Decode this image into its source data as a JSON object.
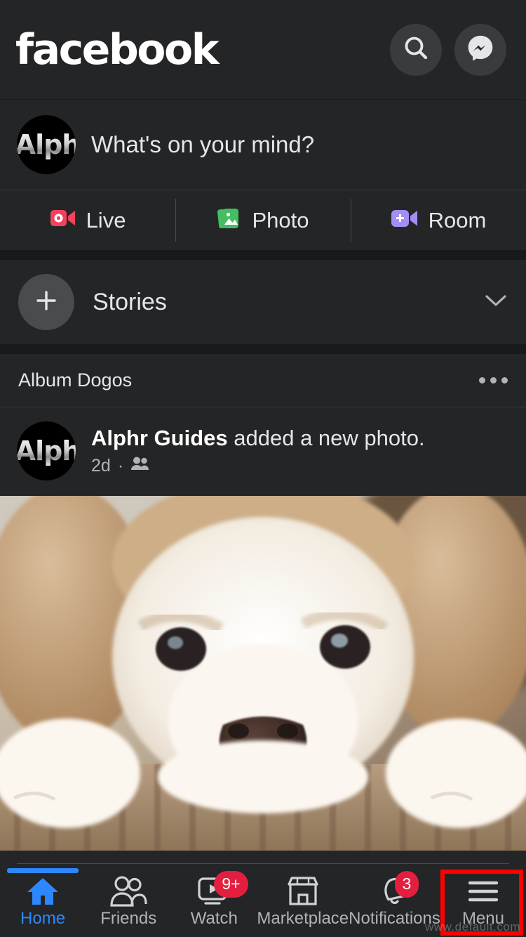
{
  "app": {
    "brand": "facebook",
    "theme_bg": "#242526",
    "page_bg": "#18191a",
    "accent": "#2d88ff",
    "badge_color": "#e41e3f",
    "highlight_color": "#ff0000"
  },
  "header": {
    "wordmark": "facebook",
    "search_icon": "search-icon",
    "messenger_icon": "messenger-icon"
  },
  "composer": {
    "avatar_text": "Alph",
    "placeholder": "What's on your mind?",
    "actions": [
      {
        "label": "Live",
        "icon": "live-video-icon",
        "color": "#f3425f"
      },
      {
        "label": "Photo",
        "icon": "photo-icon",
        "color": "#45bd62"
      },
      {
        "label": "Room",
        "icon": "video-room-icon",
        "color": "#a48df5"
      }
    ]
  },
  "stories": {
    "add_icon": "plus-icon",
    "title": "Stories",
    "collapse_icon": "chevron-down-icon"
  },
  "album": {
    "label": "Album Dogos",
    "menu_icon": "more-options-icon"
  },
  "post": {
    "avatar_text": "Alph",
    "author": "Alphr Guides",
    "action_text": " added a new photo.",
    "time": "2d",
    "separator": "·",
    "audience_icon": "friends-audience-icon",
    "photo_alt": "puppy-photo"
  },
  "bottom_nav": {
    "items": [
      {
        "label": "Home",
        "icon": "home-icon",
        "active": true,
        "badge": ""
      },
      {
        "label": "Friends",
        "icon": "friends-icon",
        "active": false,
        "badge": ""
      },
      {
        "label": "Watch",
        "icon": "watch-icon",
        "active": false,
        "badge": "9+"
      },
      {
        "label": "Marketplace",
        "icon": "marketplace-icon",
        "active": false,
        "badge": ""
      },
      {
        "label": "Notifications",
        "icon": "bell-icon",
        "active": false,
        "badge": "3"
      },
      {
        "label": "Menu",
        "icon": "hamburger-menu-icon",
        "active": false,
        "badge": ""
      }
    ]
  },
  "annotation": {
    "highlighted_item": "Menu",
    "watermark": "www.default.com"
  }
}
